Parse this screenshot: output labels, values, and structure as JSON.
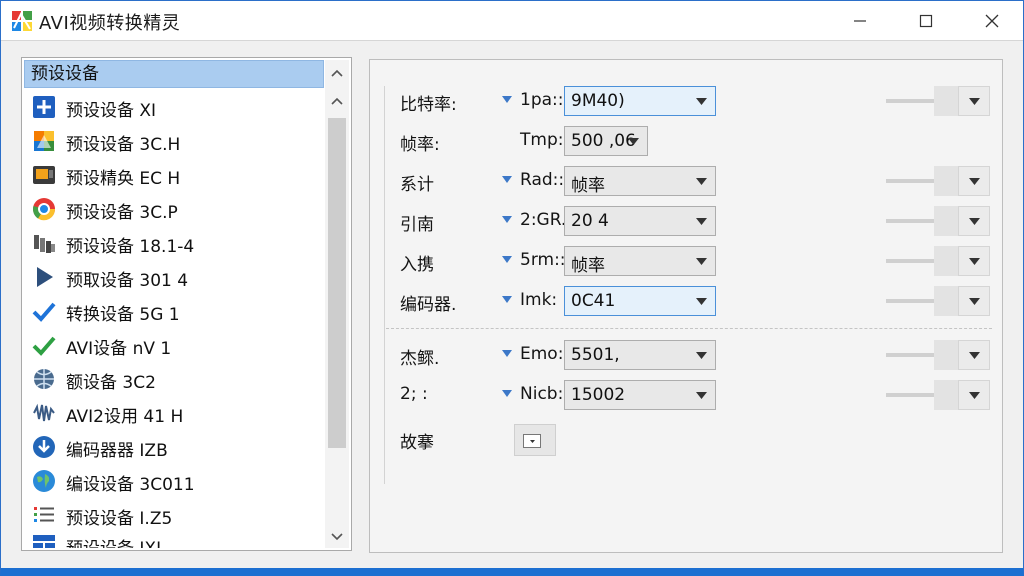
{
  "window": {
    "title": "AVI视频转换精灵",
    "icons": {
      "app": "app-logo-icon",
      "minimize": "minimize-icon",
      "maximize": "maximize-icon",
      "close": "close-icon"
    }
  },
  "preset_list": {
    "header": "预设设备",
    "items": [
      {
        "label": "预设设备 XI",
        "icon": "plus-square-icon"
      },
      {
        "label": "预设设备 3C.H",
        "icon": "colorful-cube-icon"
      },
      {
        "label": "预设精奂 EC H",
        "icon": "video-camera-icon"
      },
      {
        "label": "预设设备 3C.P",
        "icon": "chrome-ball-icon"
      },
      {
        "label": "预设设备 18.1-4",
        "icon": "film-bars-icon"
      },
      {
        "label": "预取设备 301 4",
        "icon": "play-icon"
      },
      {
        "label": "转换设备 5G   1",
        "icon": "blue-check-icon"
      },
      {
        "label": "AVI设备 nV   1",
        "icon": "green-check-icon"
      },
      {
        "label": "额设备 3C2",
        "icon": "globe-grid-icon"
      },
      {
        "label": "AVI2设用 41 H",
        "icon": "waveform-icon"
      },
      {
        "label": "编码器器 IZB",
        "icon": "download-circle-icon"
      },
      {
        "label": "编设设备 3C011",
        "icon": "earth-icon"
      },
      {
        "label": "预设设备 I.Z5",
        "icon": "list-lines-icon"
      },
      {
        "label": "预设设备 IXI",
        "icon": "grid-window-icon"
      }
    ]
  },
  "settings": {
    "rows": [
      {
        "label": "比特率:",
        "sublabel": "1pa::",
        "value": "9M40)",
        "focused": true
      },
      {
        "label": "帧率:",
        "sublabel": "Tmp:",
        "value": "500 ,06"
      },
      {
        "label": "系计",
        "sublabel": "Rad::",
        "value": "帧率"
      },
      {
        "label": "引南",
        "sublabel": "2:GR.",
        "value": "20 4"
      },
      {
        "label": "入携",
        "sublabel": "5rm::",
        "value": "帧率"
      },
      {
        "label": "编码器.",
        "sublabel": "Imk:",
        "value": "0C41",
        "focused": true
      },
      {
        "label": "杰鳏.",
        "sublabel": "Emo::",
        "value": "5501,"
      },
      {
        "label": "2;   :",
        "sublabel": "Nicb::",
        "value": "15002"
      },
      {
        "label": "故搴"
      }
    ]
  },
  "colors": {
    "accent": "#1c6fd1",
    "selection": "#aaccf0",
    "focus_border": "#4a90d9"
  }
}
